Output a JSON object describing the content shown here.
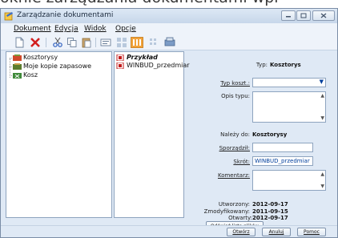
{
  "background_caption": "oknie zarządzania dokumentami wpi",
  "window": {
    "title": "Zarządzanie dokumentami"
  },
  "menu": [
    "Dokument",
    "Edycja",
    "Widok",
    "Opcje"
  ],
  "tree": {
    "items": [
      "Kosztorysy",
      "Moje kopie zapasowe",
      "Kosz"
    ]
  },
  "files": {
    "items": [
      "Przykład",
      "WINBUD_przedmiar"
    ]
  },
  "details": {
    "typ_label": "Typ:",
    "typ_value": "Kosztorys",
    "typ_koszt_label": "Typ koszt.:",
    "opis_typu_label": "Opis typu:",
    "nalezy_do_label": "Należy do:",
    "nalezy_do_value": "Kosztorysy",
    "sporzadzil_label": "Sporządził:",
    "sporzadzil_value": "",
    "skrot_label": "Skrót:",
    "skrot_value": "WINBUD_przedmiar",
    "komentarz_label": "Komentarz:",
    "utworzony_label": "Utworzony:",
    "utworzony_value": "2012-09-17",
    "zmodyfikowany_label": "Zmodyfikowany:",
    "zmodyfikowany_value": "2011-09-15",
    "otwarty_label": "Otwarty:",
    "otwarty_value": "2012-09-17",
    "refresh_label": "Odśwież listę plików"
  },
  "buttons": {
    "open": "Otwórz",
    "cancel": "Anuluj",
    "help": "Pomoc"
  },
  "colors": {
    "accent": "#003e9c",
    "red_x": "#d21f1f",
    "orange_toggle": "#f2a33a"
  }
}
